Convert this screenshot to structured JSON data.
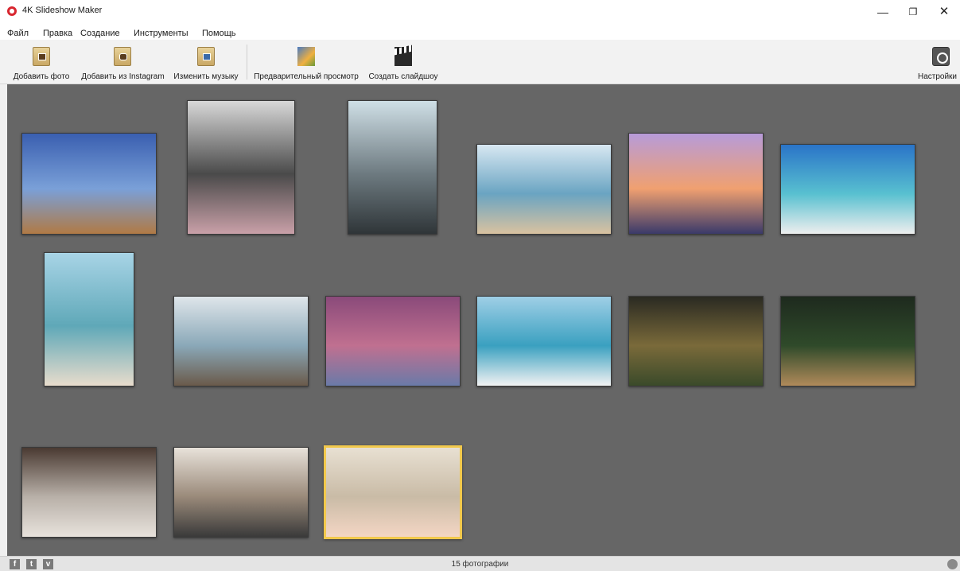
{
  "window": {
    "title": "4K Slideshow Maker",
    "minimize": "—",
    "maximize": "❐",
    "close": "✕"
  },
  "menu": [
    "Файл",
    "Правка",
    "Создание",
    "Инструменты",
    "Помощь"
  ],
  "toolbar": {
    "add_photo": "Добавить фото",
    "add_instagram": "Добавить из Instagram",
    "change_music": "Изменить музыку",
    "preview": "Предварительный просмотр",
    "create_slideshow": "Создать слайдшоу",
    "settings": "Настройки"
  },
  "status": {
    "count": "15 фотографии",
    "social": [
      "f",
      "t",
      "v"
    ]
  },
  "photos": [
    {
      "subject": "eiffel-tower",
      "colors": [
        "#3a5fb0",
        "#7aa0d8",
        "#b07a45"
      ]
    },
    {
      "subject": "woman-on-balcony",
      "colors": [
        "#d8d8d8",
        "#4a4a4a",
        "#c9a0a8"
      ]
    },
    {
      "subject": "city-skyline",
      "colors": [
        "#cfdfe6",
        "#6d7a80",
        "#2f3538"
      ]
    },
    {
      "subject": "woman-on-beach",
      "colors": [
        "#d8e8f2",
        "#6aa4c2",
        "#d9c2a0"
      ]
    },
    {
      "subject": "sunset-heart-hands",
      "colors": [
        "#b79bd9",
        "#f0a070",
        "#3a3a6a"
      ]
    },
    {
      "subject": "woman-sitting-beach",
      "colors": [
        "#2a74c8",
        "#58c0d0",
        "#eeeeee"
      ]
    },
    {
      "subject": "woman-in-water",
      "colors": [
        "#a8d4e6",
        "#5fa8b8",
        "#e8dccc"
      ]
    },
    {
      "subject": "lifeguard-tower",
      "colors": [
        "#dfe6ea",
        "#8aa8b8",
        "#6a5a4a"
      ]
    },
    {
      "subject": "family-kiss",
      "colors": [
        "#8a4a7a",
        "#c07090",
        "#6a7aa8"
      ]
    },
    {
      "subject": "woman-in-hat-beach",
      "colors": [
        "#9fcfe6",
        "#3aa0c0",
        "#f2f2f2"
      ]
    },
    {
      "subject": "christmas-tree",
      "colors": [
        "#2a2a22",
        "#7a6a3a",
        "#3a4a2a"
      ]
    },
    {
      "subject": "merry-christmas-ornament",
      "colors": [
        "#1e2a1e",
        "#2f4a2a",
        "#b08a5a"
      ]
    },
    {
      "subject": "wedding-rings",
      "colors": [
        "#4a3a32",
        "#b8b0a8",
        "#e8e2dc"
      ]
    },
    {
      "subject": "wedding-couple",
      "colors": [
        "#e8e2da",
        "#9a8a7a",
        "#3a3a3a"
      ]
    },
    {
      "subject": "baby-on-fur",
      "colors": [
        "#e8e0d2",
        "#c9bba6",
        "#f4d6c4"
      ]
    }
  ],
  "selected_photo": "baby-on-fur"
}
